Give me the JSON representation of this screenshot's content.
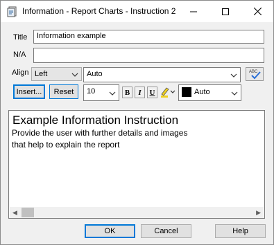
{
  "window": {
    "title": "Information - Report Charts - Instruction 2",
    "icon": "report-document-icon"
  },
  "form": {
    "title_label": "Title",
    "title_value": "Information example",
    "na_label": "N/A",
    "na_value": "",
    "align_label": "Align",
    "align_value": "Left",
    "font_value": "Auto",
    "spellcheck_icon_text": "ABC",
    "insert_label": "Insert...",
    "reset_label": "Reset",
    "size_value": "10",
    "bold_label": "B",
    "italic_label": "I",
    "underline_label": "U",
    "color_value": "Auto",
    "color_swatch": "#000000"
  },
  "editor": {
    "heading": "Example Information Instruction",
    "body": "Provide the user with further details and images\nthat help to explain the report"
  },
  "buttons": {
    "ok": "OK",
    "cancel": "Cancel",
    "help": "Help"
  },
  "colors": {
    "accent": "#0078d7"
  }
}
